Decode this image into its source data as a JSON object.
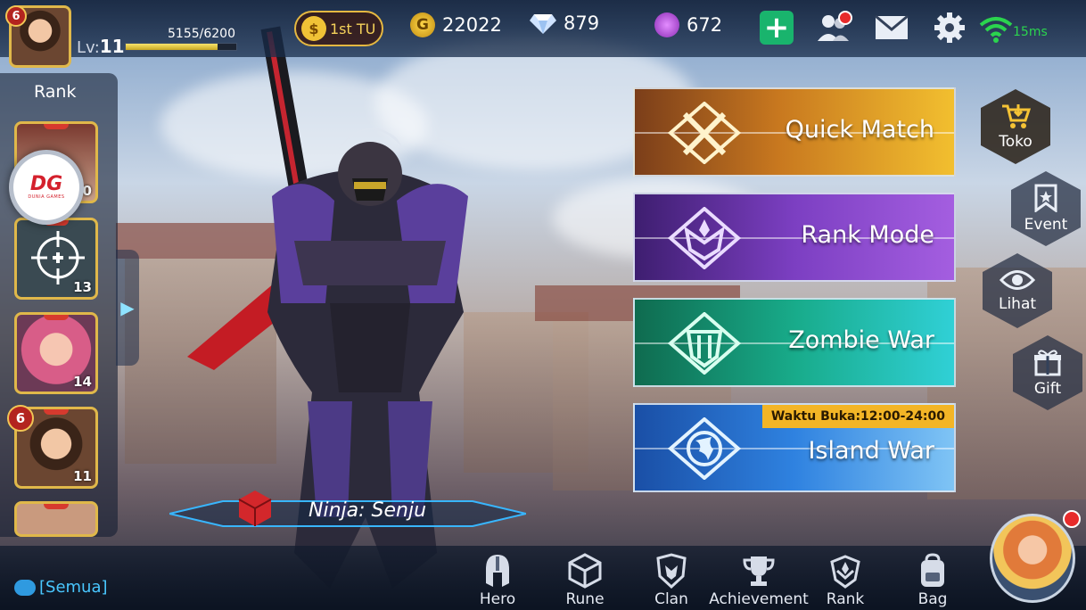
{
  "player": {
    "level_label": "Lv:",
    "level": "11",
    "notifications": "6",
    "xp": "5155/6200",
    "xp_progress": 0.8315
  },
  "top_bar": {
    "rank_badge": "1st TU",
    "gold": "22022",
    "diamonds": "879",
    "crystals": "672",
    "ping": "15ms",
    "icons": [
      "plus-icon",
      "friends-icon",
      "mail-icon",
      "gear-icon",
      "wifi-icon"
    ]
  },
  "left_panel": {
    "title": "Rank",
    "heroes": [
      {
        "level": "20"
      },
      {
        "level": "13"
      },
      {
        "level": "14"
      },
      {
        "level": "11",
        "badge": "6"
      }
    ]
  },
  "hero": {
    "name": "Ninja: Senju"
  },
  "modes": [
    {
      "label": "Quick Match"
    },
    {
      "label": "Rank Mode"
    },
    {
      "label": "Zombie War"
    },
    {
      "label": "Island War",
      "open_time": "Waktu Buka:12:00-24:00"
    }
  ],
  "side_buttons": [
    {
      "label": "Toko",
      "icon": "cart-icon"
    },
    {
      "label": "Event",
      "icon": "bookmark-icon"
    },
    {
      "label": "Lihat",
      "icon": "eye-icon"
    },
    {
      "label": "Gift",
      "icon": "gift-icon"
    }
  ],
  "bottom_nav": [
    {
      "label": "Hero",
      "icon": "helmet-icon"
    },
    {
      "label": "Rune",
      "icon": "cube-icon"
    },
    {
      "label": "Clan",
      "icon": "shield-icon"
    },
    {
      "label": "Achievement",
      "icon": "trophy-icon"
    },
    {
      "label": "Rank",
      "icon": "rank-emblem-icon"
    },
    {
      "label": "Bag",
      "icon": "backpack-icon"
    }
  ],
  "chat": {
    "channel": "[Semua]"
  },
  "colors": {
    "accent_gold": "#e0b84a",
    "online_green": "#2bd44e",
    "chat_blue": "#49c7ff",
    "alert_red": "#e72b2b"
  }
}
